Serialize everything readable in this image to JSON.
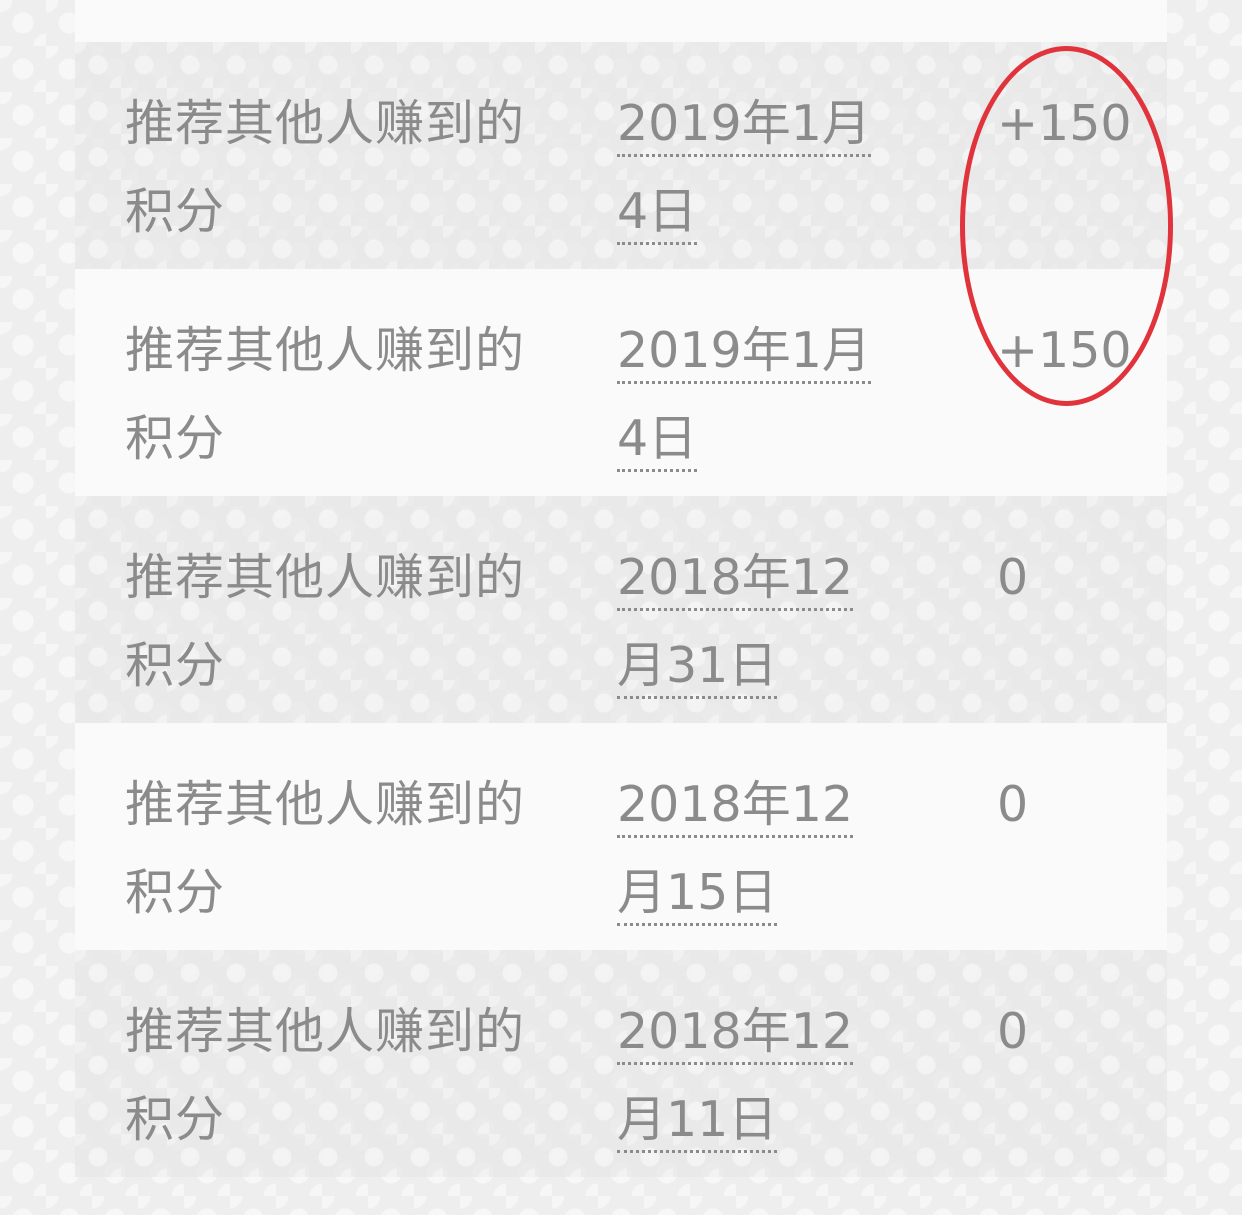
{
  "rows": [
    {
      "description": "推荐其他人赚到的积分",
      "date": "2019年1月4日",
      "points": "+150"
    },
    {
      "description": "推荐其他人赚到的积分",
      "date": "2019年1月4日",
      "points": "+150"
    },
    {
      "description": "推荐其他人赚到的积分",
      "date": "2018年12月31日",
      "points": "0"
    },
    {
      "description": "推荐其他人赚到的积分",
      "date": "2018年12月15日",
      "points": "0"
    },
    {
      "description": "推荐其他人赚到的积分",
      "date": "2018年12月11日",
      "points": "0"
    }
  ],
  "colors": {
    "text": "#8b8b8b",
    "row_shaded": "#e8e8e8",
    "row_plain": "#fafafa",
    "highlight": "#e0333c"
  }
}
